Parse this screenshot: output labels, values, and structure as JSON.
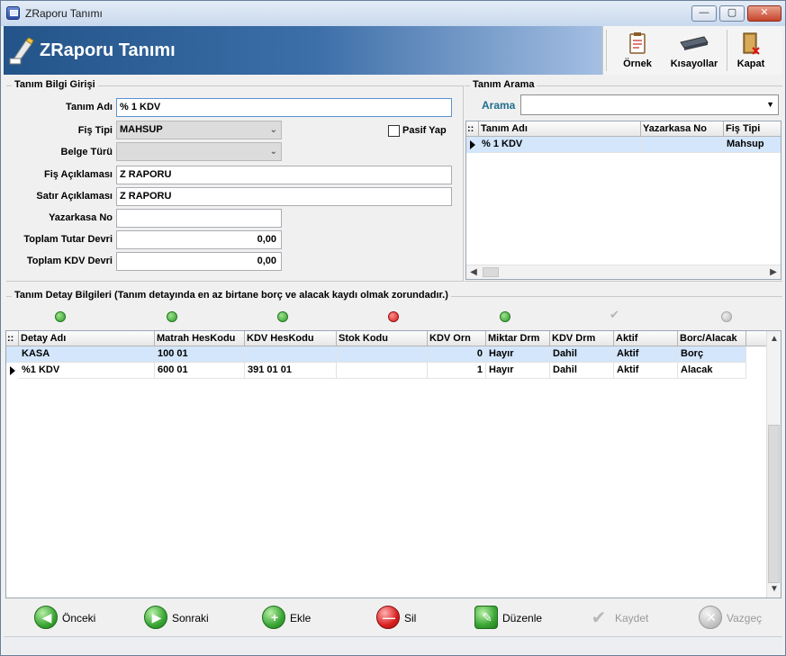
{
  "window": {
    "title": "ZRaporu Tanımı",
    "minimize_glyph": "—",
    "maximize_glyph": "▢",
    "close_glyph": "✕"
  },
  "banner": {
    "title": "ZRaporu Tanımı"
  },
  "toolbar": {
    "ornek_label": "Örnek",
    "kisayollar_label": "Kısayollar",
    "kapat_label": "Kapat"
  },
  "form": {
    "section_title": "Tanım Bilgi Girişi",
    "tanim_adi": {
      "label": "Tanım Adı",
      "value": "% 1 KDV"
    },
    "fis_tipi": {
      "label": "Fiş Tipi",
      "value": "MAHSUP"
    },
    "pasif_yap": {
      "label": "Pasif Yap",
      "checked": false
    },
    "belge_turu": {
      "label": "Belge Türü",
      "value": ""
    },
    "fis_aciklamasi": {
      "label": "Fiş Açıklaması",
      "value": "Z RAPORU"
    },
    "satir_aciklamasi": {
      "label": "Satır Açıklaması",
      "value": "Z RAPORU"
    },
    "yazarkasa_no": {
      "label": "Yazarkasa No",
      "value": ""
    },
    "toplam_tutar_devri": {
      "label": "Toplam Tutar Devri",
      "value": "0,00"
    },
    "toplam_kdv_devri": {
      "label": "Toplam KDV Devri",
      "value": "0,00"
    }
  },
  "search": {
    "section_title": "Tanım Arama",
    "label": "Arama",
    "value": "",
    "arrow_glyph": "▼",
    "grid": {
      "corner": "::",
      "columns": [
        "Tanım Adı",
        "Yazarkasa No",
        "Fiş Tipi"
      ],
      "rows": [
        {
          "tanim_adi": "% 1 KDV",
          "yazarkasa_no": "",
          "fis_tipi": "Mahsup"
        }
      ]
    }
  },
  "detail": {
    "section_title": "Tanım Detay Bilgileri (Tanım detayında en az birtane borç ve alacak kaydı olmak zorundadır.)",
    "grid": {
      "corner": "::",
      "columns": [
        "Detay Adı",
        "Matrah HesKodu",
        "KDV HesKodu",
        "Stok Kodu",
        "KDV Orn",
        "Miktar Drm",
        "KDV Drm",
        "Aktif",
        "Borc/Alacak"
      ],
      "rows": [
        {
          "detay_adi": "KASA",
          "matrah": "100 01",
          "kdv_hes": "",
          "stok": "",
          "kdv_orn": "0",
          "miktar": "Hayır",
          "kdv_drm": "Dahil",
          "aktif": "Aktif",
          "borc_alacak": "Borç"
        },
        {
          "detay_adi": "%1 KDV",
          "matrah": "600 01",
          "kdv_hes": "391 01 01",
          "stok": "",
          "kdv_orn": "1",
          "miktar": "Hayır",
          "kdv_drm": "Dahil",
          "aktif": "Aktif",
          "borc_alacak": "Alacak"
        }
      ]
    }
  },
  "scroll": {
    "up": "▲",
    "down": "▼",
    "left": "◀",
    "right": "▶"
  },
  "buttons": {
    "onceki": "Önceki",
    "sonraki": "Sonraki",
    "ekle": "Ekle",
    "sil": "Sil",
    "duzenle": "Düzenle",
    "kaydet": "Kaydet",
    "vazgec": "Vazgeç"
  },
  "glyphs": {
    "prev": "◀",
    "next": "▶",
    "plus": "+",
    "minus": "—",
    "edit": "✎",
    "check": "✔",
    "cross": "✕",
    "row_indicator": "▶"
  },
  "colors": {
    "banner_dark": "#235489",
    "selection": "#d3e6fb",
    "search_label": "#1f6e8c"
  }
}
